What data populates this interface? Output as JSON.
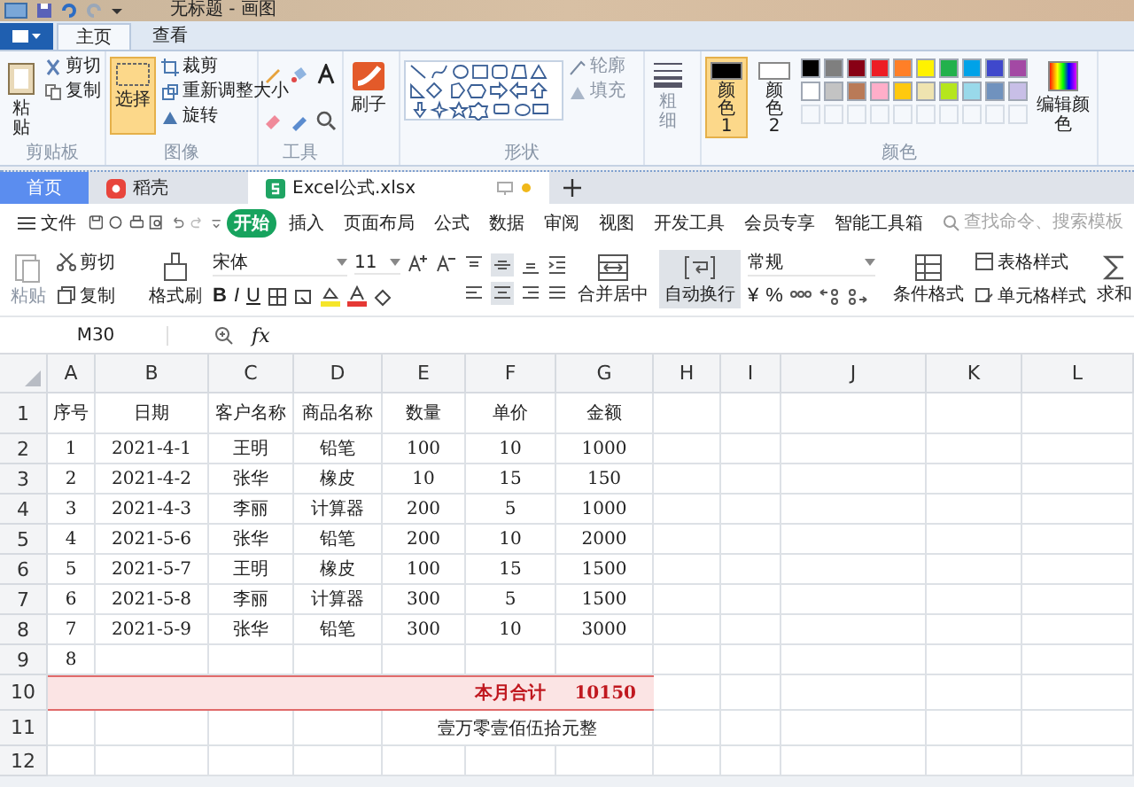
{
  "paint": {
    "title": "无标题 - 画图",
    "tabs": [
      {
        "label": "主页",
        "selected": true
      },
      {
        "label": "查看",
        "selected": false
      }
    ],
    "clipboard": {
      "paste": "粘贴",
      "cut": "剪切",
      "copy": "复制",
      "group": "剪贴板"
    },
    "image": {
      "select": "选择",
      "select_active": true,
      "crop": "裁剪",
      "resize": "重新调整大小",
      "rotate": "旋转",
      "group": "图像"
    },
    "tools": {
      "group": "工具"
    },
    "brush": {
      "label": "刷子"
    },
    "shapes": {
      "outline": "轮廓",
      "fill": "填充",
      "group": "形状"
    },
    "size": {
      "label": "粗细"
    },
    "colors": {
      "slots": [
        {
          "label": "颜色 1",
          "color": "#000000",
          "selected": true
        },
        {
          "label": "颜色 2",
          "color": "#ffffff",
          "selected": false
        }
      ],
      "palette": [
        {
          "color": "#000000"
        },
        {
          "color": "#7f7f7f"
        },
        {
          "color": "#880015"
        },
        {
          "color": "#ed1c24"
        },
        {
          "color": "#ff7f27"
        },
        {
          "color": "#fff200"
        },
        {
          "color": "#22b14c"
        },
        {
          "color": "#00a2e8"
        },
        {
          "color": "#3f48cc"
        },
        {
          "color": "#a349a4"
        },
        {
          "color": "#ffffff"
        },
        {
          "color": "#c3c3c3"
        },
        {
          "color": "#b97a57"
        },
        {
          "color": "#ffaec9"
        },
        {
          "color": "#ffc90e"
        },
        {
          "color": "#efe4b0"
        },
        {
          "color": "#b5e61d"
        },
        {
          "color": "#99d9ea"
        },
        {
          "color": "#7092be"
        },
        {
          "color": "#c8bfe7"
        }
      ],
      "edit": "编辑颜色",
      "group": "颜色"
    }
  },
  "wps": {
    "tabs": [
      {
        "label": "首页",
        "kind": "home",
        "selected": false
      },
      {
        "label": "稻壳",
        "kind": "docer",
        "selected": false
      },
      {
        "label": "Excel公式.xlsx",
        "kind": "sheet",
        "selected": true
      }
    ],
    "file_menu": "文件",
    "menu": [
      {
        "label": "开始",
        "selected": true
      },
      {
        "label": "插入",
        "selected": false
      },
      {
        "label": "页面布局",
        "selected": false
      },
      {
        "label": "公式",
        "selected": false
      },
      {
        "label": "数据",
        "selected": false
      },
      {
        "label": "审阅",
        "selected": false
      },
      {
        "label": "视图",
        "selected": false
      },
      {
        "label": "开发工具",
        "selected": false
      },
      {
        "label": "会员专享",
        "selected": false
      },
      {
        "label": "智能工具箱",
        "selected": false
      }
    ],
    "search": {
      "placeholder": "查找命令、搜索模板"
    },
    "toolbar": {
      "paste": "粘贴",
      "cut": "剪切",
      "copy": "复制",
      "format_painter": "格式刷",
      "font": "宋体",
      "font_size": "11",
      "bold": "B",
      "italic": "I",
      "underline": "U",
      "merge": "合并居中",
      "wrap": {
        "label": "自动换行",
        "active": true
      },
      "number_format": "常规",
      "currency": "¥",
      "percent": "%",
      "conditional": "条件格式",
      "table_style": "表格样式",
      "cell_style": "单元格样式",
      "sum": "求和"
    },
    "name_box": "M30",
    "fx": "fx",
    "sheet": {
      "columns": [
        "A",
        "B",
        "C",
        "D",
        "E",
        "F",
        "G",
        "H",
        "I",
        "J",
        "K",
        "L"
      ],
      "rows": [
        {
          "header": "1",
          "kind": "data",
          "cells": [
            "序号",
            "日期",
            "客户名称",
            "商品名称",
            "数量",
            "单价",
            "金额"
          ]
        },
        {
          "header": "2",
          "kind": "data",
          "cells": [
            "1",
            "2021-4-1",
            "王明",
            "铅笔",
            "100",
            "10",
            "1000"
          ]
        },
        {
          "header": "3",
          "kind": "data",
          "cells": [
            "2",
            "2021-4-2",
            "张华",
            "橡皮",
            "10",
            "15",
            "150"
          ]
        },
        {
          "header": "4",
          "kind": "data",
          "cells": [
            "3",
            "2021-4-3",
            "李丽",
            "计算器",
            "200",
            "5",
            "1000"
          ]
        },
        {
          "header": "5",
          "kind": "data",
          "cells": [
            "4",
            "2021-5-6",
            "张华",
            "铅笔",
            "200",
            "10",
            "2000"
          ]
        },
        {
          "header": "6",
          "kind": "data",
          "cells": [
            "5",
            "2021-5-7",
            "王明",
            "橡皮",
            "100",
            "15",
            "1500"
          ]
        },
        {
          "header": "7",
          "kind": "data",
          "cells": [
            "6",
            "2021-5-8",
            "李丽",
            "计算器",
            "300",
            "5",
            "1500"
          ]
        },
        {
          "header": "8",
          "kind": "data",
          "cells": [
            "7",
            "2021-5-9",
            "张华",
            "铅笔",
            "300",
            "10",
            "3000"
          ]
        },
        {
          "header": "9",
          "kind": "data",
          "cells": [
            "8"
          ]
        },
        {
          "header": "10",
          "kind": "total",
          "label": "本月合计",
          "value": "10150"
        },
        {
          "header": "11",
          "kind": "words",
          "text": "壹万零壹佰伍拾元整"
        },
        {
          "header": "12",
          "kind": "data"
        }
      ]
    }
  }
}
